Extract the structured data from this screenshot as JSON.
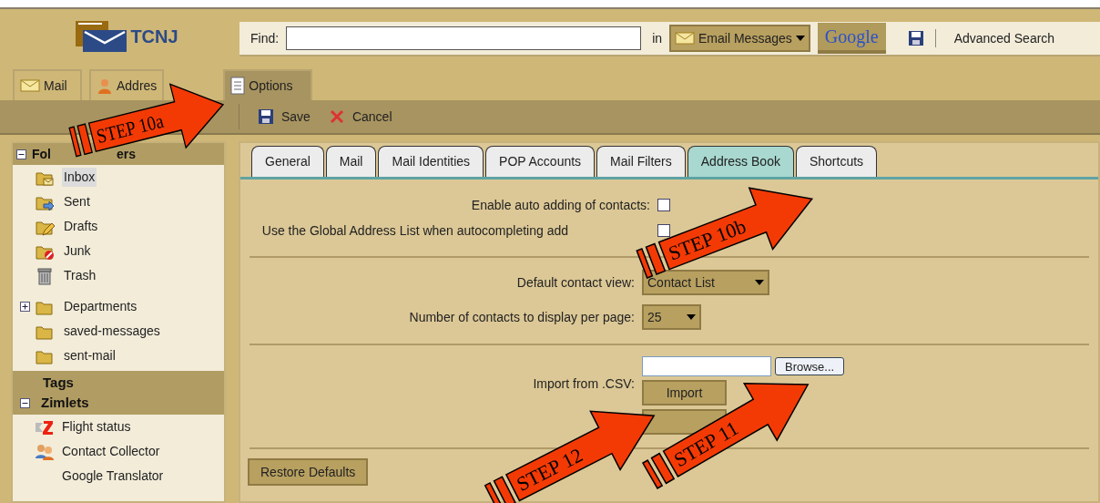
{
  "logo": {
    "text": "TCNJ"
  },
  "search": {
    "label": "Find:",
    "in_label": "in",
    "scope": "Email Messages",
    "google": "Google",
    "advanced": "Advanced Search"
  },
  "app_tabs": [
    {
      "label": "Mail",
      "selected": false
    },
    {
      "label": "Addres",
      "selected": false
    },
    {
      "label": "Options",
      "selected": true
    }
  ],
  "toolbar": [
    {
      "label": "Save"
    },
    {
      "label": "Cancel"
    }
  ],
  "sidebar": {
    "folders_header": "Fol",
    "folders_header_end": "ers",
    "folders": [
      {
        "label": "Inbox",
        "kind": "inbox",
        "selected": true
      },
      {
        "label": "Sent",
        "kind": "sent",
        "selected": false
      },
      {
        "label": "Drafts",
        "kind": "drafts",
        "selected": false
      },
      {
        "label": "Junk",
        "kind": "junk",
        "selected": false
      },
      {
        "label": "Trash",
        "kind": "trash",
        "selected": false
      },
      {
        "label": "Departments",
        "kind": "folder",
        "selected": false,
        "expanded": false
      },
      {
        "label": "saved-messages",
        "kind": "folder",
        "selected": false
      },
      {
        "label": "sent-mail",
        "kind": "folder",
        "selected": false
      }
    ],
    "tags_header": "Tags",
    "zimlets_header": "Zimlets",
    "zimlets": [
      {
        "label": "Flight status",
        "kind": "flight"
      },
      {
        "label": "Contact Collector",
        "kind": "contacts"
      },
      {
        "label": "Google Translator",
        "kind": "none"
      }
    ]
  },
  "settings_tabs": [
    {
      "label": "General",
      "selected": false
    },
    {
      "label": "Mail",
      "selected": false
    },
    {
      "label": "Mail Identities",
      "selected": false
    },
    {
      "label": "POP Accounts",
      "selected": false
    },
    {
      "label": "Mail Filters",
      "selected": false
    },
    {
      "label": "Address Book",
      "selected": true
    },
    {
      "label": "Shortcuts",
      "selected": false
    }
  ],
  "settings": {
    "auto_add": {
      "label": "Enable auto adding of contacts:",
      "checked": false
    },
    "gal": {
      "label": "Use the Global Address List when autocompleting add",
      "checked": false
    },
    "default_view": {
      "label": "Default contact view:",
      "value": "Contact List"
    },
    "per_page": {
      "label": "Number of contacts to display per page:",
      "value": "25"
    },
    "import": {
      "label": "Import from .CSV:",
      "browse": "Browse...",
      "button": "Import"
    },
    "restore": "Restore Defaults"
  },
  "callouts": [
    {
      "label": "STEP 10a"
    },
    {
      "label": "STEP 10b"
    },
    {
      "label": "STEP 12"
    },
    {
      "label": "STEP 11"
    }
  ]
}
